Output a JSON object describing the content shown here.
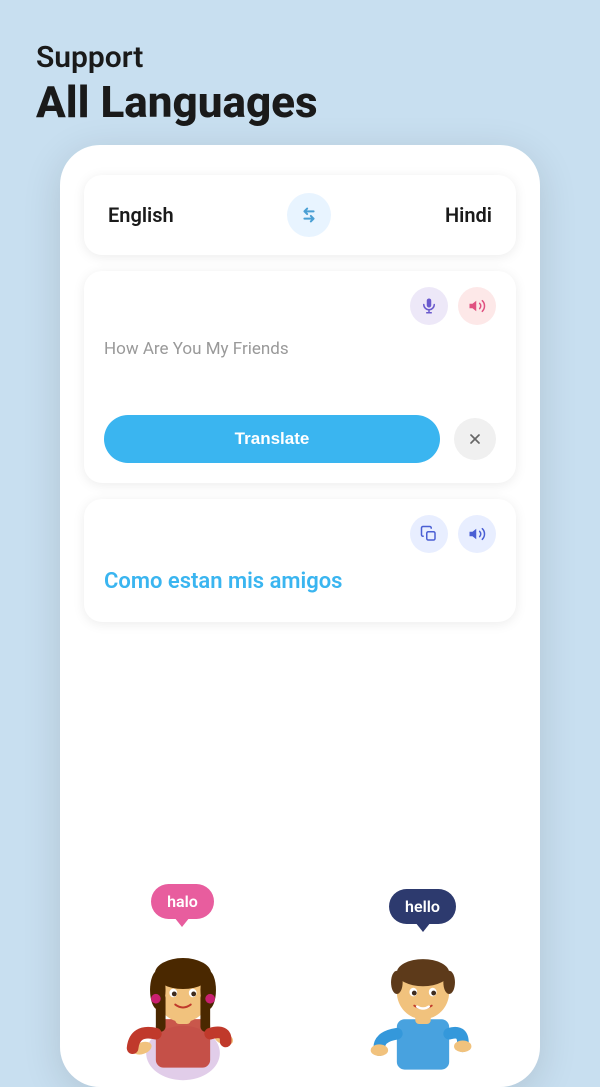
{
  "header": {
    "support_label": "Support",
    "all_languages_label": "All Languages"
  },
  "language_selector": {
    "source_lang": "English",
    "target_lang": "Hindi",
    "swap_icon": "⇄"
  },
  "input_card": {
    "placeholder_text": "How Are You My Friends",
    "translate_button": "Translate",
    "close_icon": "✕",
    "mic_icon": "🎤",
    "speaker_icon": "🔊"
  },
  "output_card": {
    "translated_text": "Como estan mis amigos",
    "copy_icon": "📋",
    "speaker_icon": "🔊"
  },
  "characters": {
    "bubble_left": "halo",
    "bubble_right": "hello"
  }
}
